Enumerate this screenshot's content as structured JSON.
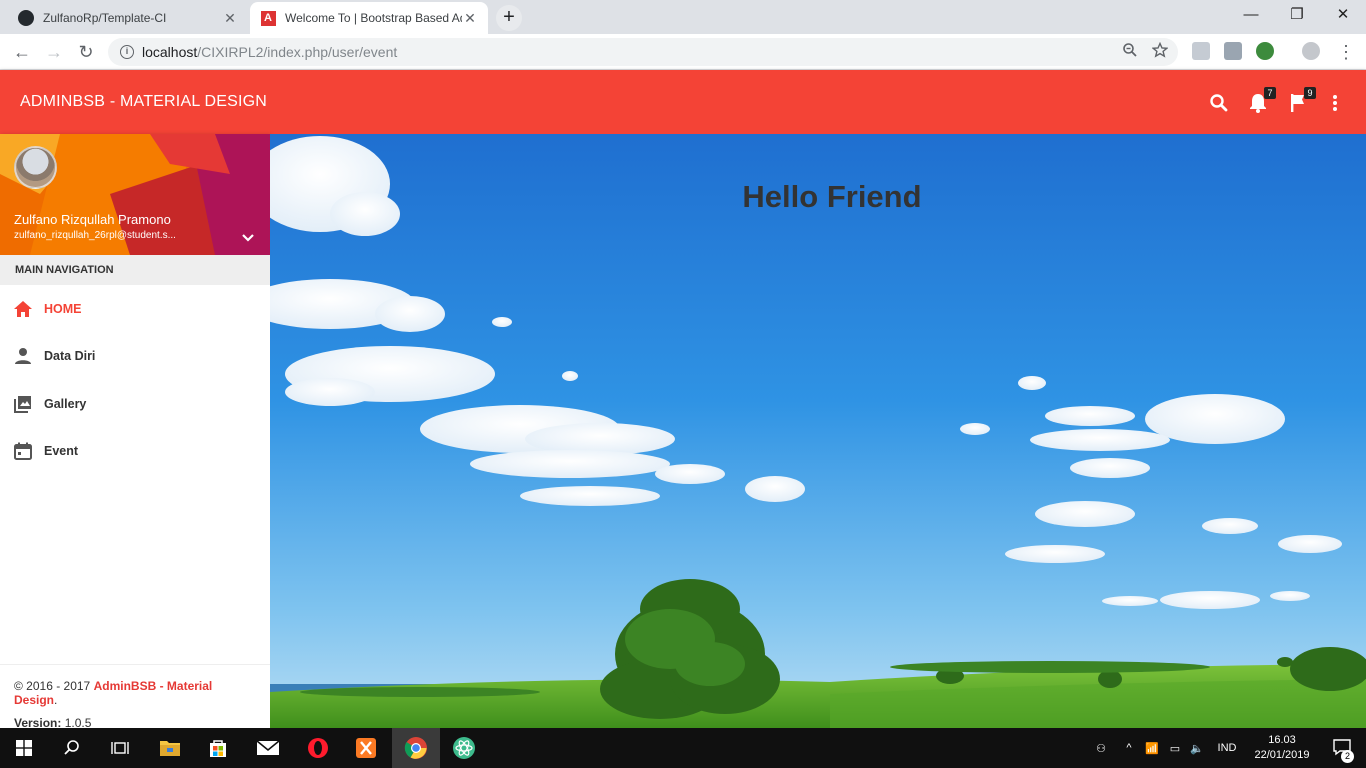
{
  "browser": {
    "tabs": [
      {
        "title": "ZulfanoRp/Template-CI",
        "favicon": "github-icon",
        "active": false
      },
      {
        "title": "Welcome To | Bootstrap Based Ad",
        "favicon": "adminbsb-icon",
        "active": true
      }
    ],
    "url_host": "localhost",
    "url_path": "/CIXIRPL2/index.php/user/event"
  },
  "header": {
    "brand": "ADMINBSB - MATERIAL DESIGN",
    "notifications_count": "7",
    "tasks_count": "9"
  },
  "user": {
    "name": "Zulfano Rizqullah Pramono",
    "email": "zulfano_rizqullah_26rpl@student.s..."
  },
  "sidebar": {
    "heading": "MAIN NAVIGATION",
    "items": [
      {
        "label": "HOME",
        "icon": "home-icon",
        "active": true
      },
      {
        "label": "Data Diri",
        "icon": "person-icon",
        "active": false
      },
      {
        "label": "Gallery",
        "icon": "gallery-icon",
        "active": false
      },
      {
        "label": "Event",
        "icon": "calendar-icon",
        "active": false
      }
    ],
    "legal": {
      "copy_prefix": "© 2016 - 2017 ",
      "copy_link": "AdminBSB - Material Design",
      "copy_suffix": ".",
      "version_label": "Version:",
      "version_value": " 1.0.5"
    }
  },
  "content": {
    "heading": "Hello Friend"
  },
  "taskbar": {
    "language": "IND",
    "time": "16.03",
    "date": "22/01/2019",
    "notification_count": "2"
  },
  "colors": {
    "header": "#f44336",
    "active_nav": "#f44336"
  }
}
